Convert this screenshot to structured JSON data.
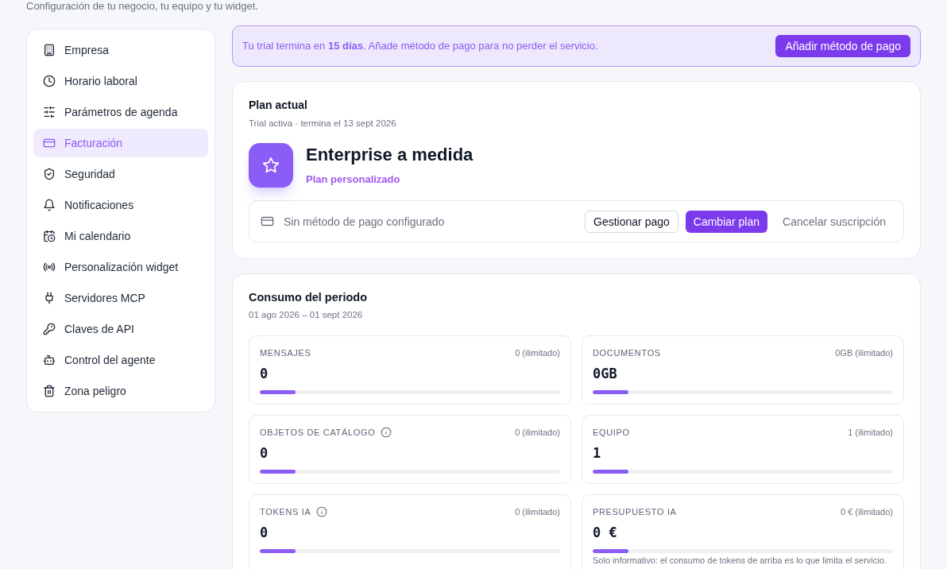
{
  "page": {
    "subtitle": "Configuración de tu negocio, tu equipo y tu widget."
  },
  "sidebar": {
    "items": [
      {
        "label": "Empresa",
        "selected": false
      },
      {
        "label": "Horario laboral",
        "selected": false
      },
      {
        "label": "Parámetros de agenda",
        "selected": false
      },
      {
        "label": "Facturación",
        "selected": true
      },
      {
        "label": "Seguridad",
        "selected": false
      },
      {
        "label": "Notificaciones",
        "selected": false
      },
      {
        "label": "Mi calendario",
        "selected": false
      },
      {
        "label": "Personalización widget",
        "selected": false
      },
      {
        "label": "Servidores MCP",
        "selected": false
      },
      {
        "label": "Claves de API",
        "selected": false
      },
      {
        "label": "Control del agente",
        "selected": false
      },
      {
        "label": "Zona peligro",
        "selected": false
      }
    ]
  },
  "trial_banner": {
    "message": "Tu trial termina en **15 días**. Añade método de pago para no perder el servicio.",
    "button": "Añadir método de pago"
  },
  "plan_card": {
    "title": "Plan actual",
    "status": "Trial activa · termina el 13 sept 2026",
    "plan_name": "Enterprise a medida",
    "plan_type": "Plan personalizado",
    "payment_method": "Sin método de pago configurado",
    "buttons": [
      {
        "label": "Gestionar pago",
        "kind": "outline"
      },
      {
        "label": "Cambiar plan",
        "kind": "primary"
      },
      {
        "label": "Cancelar suscripción",
        "kind": "link"
      }
    ]
  },
  "usage_card": {
    "title": "Consumo del periodo",
    "period": "01 ago 2026 – 01 sept 2026",
    "meters": [
      {
        "label": "MENSAJES",
        "info": false,
        "limit": "0 (ilimitado)",
        "value": "0",
        "level": 0.12
      },
      {
        "label": "DOCUMENTOS",
        "info": false,
        "limit": "0GB (ilimitado)",
        "value": "0GB",
        "level": 0.12
      },
      {
        "label": "OBJETOS DE CATÁLOGO",
        "info": true,
        "limit": "0 (ilimitado)",
        "value": "0",
        "level": 0.12
      },
      {
        "label": "EQUIPO",
        "info": false,
        "limit": "1 (ilimitado)",
        "value": "1",
        "level": 0.12
      },
      {
        "label": "TOKENS IA",
        "info": true,
        "limit": "0 (ilimitado)",
        "value": "0",
        "level": 0.12
      },
      {
        "label": "PRESUPUESTO IA",
        "info": false,
        "limit": "0 € (ilimitado)",
        "value": "0 €",
        "level": 0.12,
        "note": "Solo informativo: el consumo de tokens de arriba es lo que limita el servicio."
      }
    ]
  }
}
